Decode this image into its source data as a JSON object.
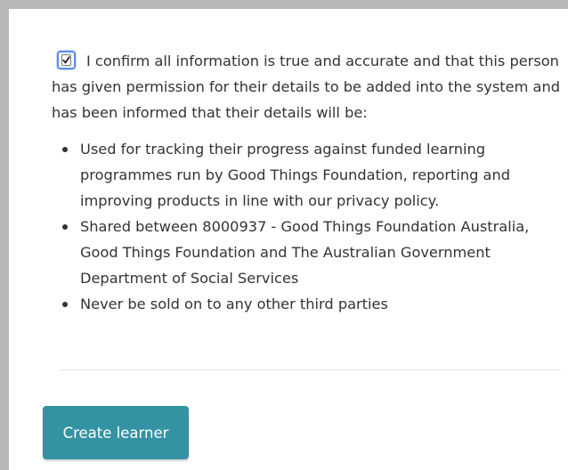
{
  "consent": {
    "checkbox_checked": true,
    "intro_text": "I confirm all information is true and accurate and that this person has given permission for their details to be added into the system and has been informed that their details will be:",
    "bullets": [
      "Used for tracking their progress against funded learning programmes run by Good Things Foundation, reporting and improving products in line with our privacy policy.",
      "Shared between 8000937 - Good Things Foundation Australia, Good Things Foundation and The Australian Government Department of Social Services",
      "Never be sold on to any other third parties"
    ]
  },
  "actions": {
    "create_label": "Create learner"
  },
  "colors": {
    "button_bg": "#3393a2",
    "checkbox_focus": "#5b8ee8",
    "frame_border": "#b8b8b8",
    "text": "#333333"
  },
  "icons": {
    "checkbox": "check-icon"
  }
}
